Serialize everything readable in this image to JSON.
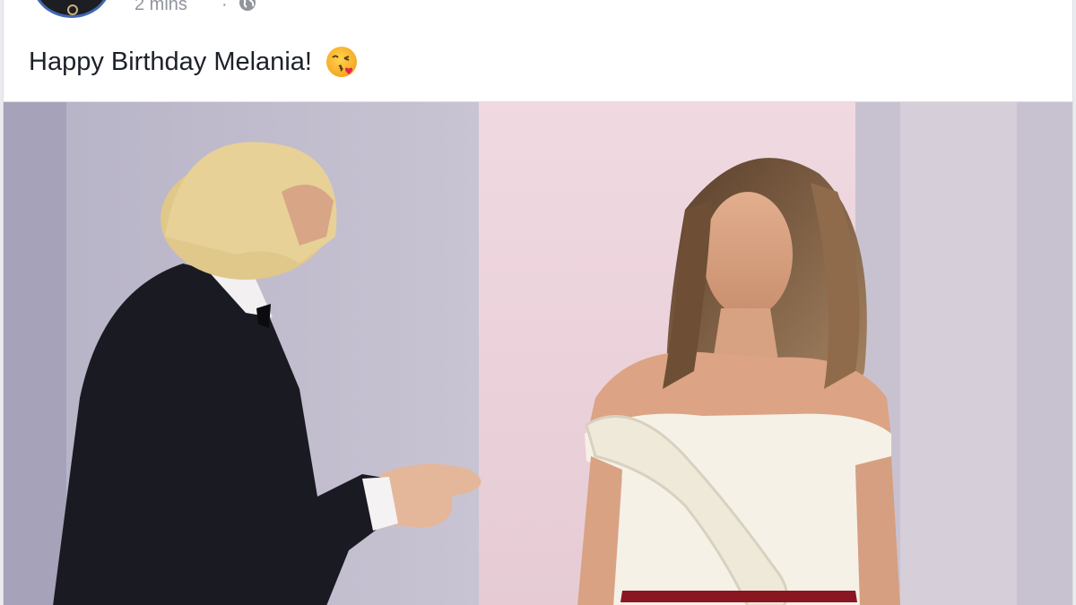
{
  "post": {
    "timestamp": "2 mins",
    "separator": "·",
    "privacy_icon": "globe-icon",
    "message": "Happy Birthday Melania!",
    "emoji": "face-blowing-a-kiss-icon"
  },
  "colors": {
    "page_bg": "#e9ebee",
    "card_bg": "#ffffff",
    "text": "#1d2129",
    "meta_text": "#90949c",
    "avatar_ring": "#4267b2"
  }
}
